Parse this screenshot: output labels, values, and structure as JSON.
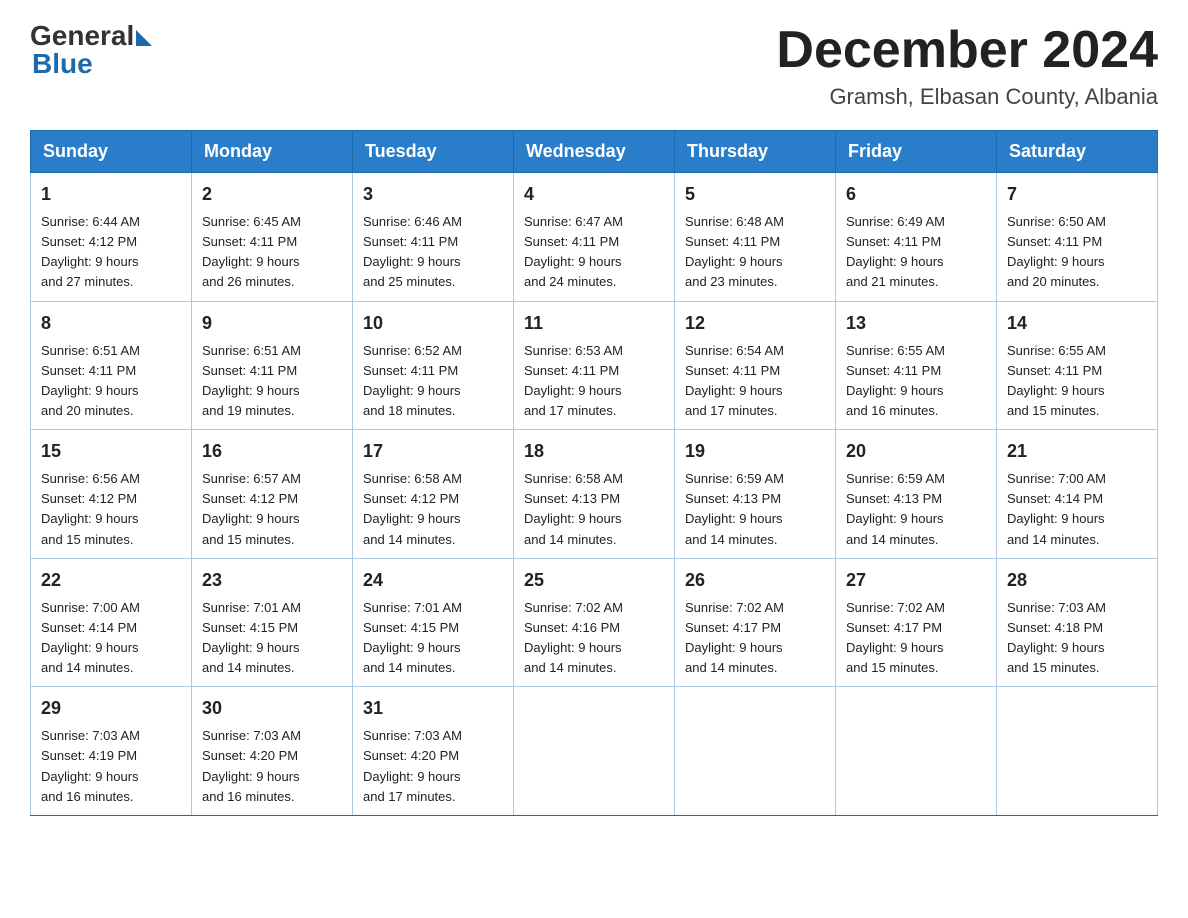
{
  "header": {
    "logo_general": "General",
    "logo_blue": "Blue",
    "title": "December 2024",
    "location": "Gramsh, Elbasan County, Albania"
  },
  "weekdays": [
    "Sunday",
    "Monday",
    "Tuesday",
    "Wednesday",
    "Thursday",
    "Friday",
    "Saturday"
  ],
  "weeks": [
    [
      {
        "day": "1",
        "sunrise": "6:44 AM",
        "sunset": "4:12 PM",
        "daylight": "9 hours and 27 minutes."
      },
      {
        "day": "2",
        "sunrise": "6:45 AM",
        "sunset": "4:11 PM",
        "daylight": "9 hours and 26 minutes."
      },
      {
        "day": "3",
        "sunrise": "6:46 AM",
        "sunset": "4:11 PM",
        "daylight": "9 hours and 25 minutes."
      },
      {
        "day": "4",
        "sunrise": "6:47 AM",
        "sunset": "4:11 PM",
        "daylight": "9 hours and 24 minutes."
      },
      {
        "day": "5",
        "sunrise": "6:48 AM",
        "sunset": "4:11 PM",
        "daylight": "9 hours and 23 minutes."
      },
      {
        "day": "6",
        "sunrise": "6:49 AM",
        "sunset": "4:11 PM",
        "daylight": "9 hours and 21 minutes."
      },
      {
        "day": "7",
        "sunrise": "6:50 AM",
        "sunset": "4:11 PM",
        "daylight": "9 hours and 20 minutes."
      }
    ],
    [
      {
        "day": "8",
        "sunrise": "6:51 AM",
        "sunset": "4:11 PM",
        "daylight": "9 hours and 20 minutes."
      },
      {
        "day": "9",
        "sunrise": "6:51 AM",
        "sunset": "4:11 PM",
        "daylight": "9 hours and 19 minutes."
      },
      {
        "day": "10",
        "sunrise": "6:52 AM",
        "sunset": "4:11 PM",
        "daylight": "9 hours and 18 minutes."
      },
      {
        "day": "11",
        "sunrise": "6:53 AM",
        "sunset": "4:11 PM",
        "daylight": "9 hours and 17 minutes."
      },
      {
        "day": "12",
        "sunrise": "6:54 AM",
        "sunset": "4:11 PM",
        "daylight": "9 hours and 17 minutes."
      },
      {
        "day": "13",
        "sunrise": "6:55 AM",
        "sunset": "4:11 PM",
        "daylight": "9 hours and 16 minutes."
      },
      {
        "day": "14",
        "sunrise": "6:55 AM",
        "sunset": "4:11 PM",
        "daylight": "9 hours and 15 minutes."
      }
    ],
    [
      {
        "day": "15",
        "sunrise": "6:56 AM",
        "sunset": "4:12 PM",
        "daylight": "9 hours and 15 minutes."
      },
      {
        "day": "16",
        "sunrise": "6:57 AM",
        "sunset": "4:12 PM",
        "daylight": "9 hours and 15 minutes."
      },
      {
        "day": "17",
        "sunrise": "6:58 AM",
        "sunset": "4:12 PM",
        "daylight": "9 hours and 14 minutes."
      },
      {
        "day": "18",
        "sunrise": "6:58 AM",
        "sunset": "4:13 PM",
        "daylight": "9 hours and 14 minutes."
      },
      {
        "day": "19",
        "sunrise": "6:59 AM",
        "sunset": "4:13 PM",
        "daylight": "9 hours and 14 minutes."
      },
      {
        "day": "20",
        "sunrise": "6:59 AM",
        "sunset": "4:13 PM",
        "daylight": "9 hours and 14 minutes."
      },
      {
        "day": "21",
        "sunrise": "7:00 AM",
        "sunset": "4:14 PM",
        "daylight": "9 hours and 14 minutes."
      }
    ],
    [
      {
        "day": "22",
        "sunrise": "7:00 AM",
        "sunset": "4:14 PM",
        "daylight": "9 hours and 14 minutes."
      },
      {
        "day": "23",
        "sunrise": "7:01 AM",
        "sunset": "4:15 PM",
        "daylight": "9 hours and 14 minutes."
      },
      {
        "day": "24",
        "sunrise": "7:01 AM",
        "sunset": "4:15 PM",
        "daylight": "9 hours and 14 minutes."
      },
      {
        "day": "25",
        "sunrise": "7:02 AM",
        "sunset": "4:16 PM",
        "daylight": "9 hours and 14 minutes."
      },
      {
        "day": "26",
        "sunrise": "7:02 AM",
        "sunset": "4:17 PM",
        "daylight": "9 hours and 14 minutes."
      },
      {
        "day": "27",
        "sunrise": "7:02 AM",
        "sunset": "4:17 PM",
        "daylight": "9 hours and 15 minutes."
      },
      {
        "day": "28",
        "sunrise": "7:03 AM",
        "sunset": "4:18 PM",
        "daylight": "9 hours and 15 minutes."
      }
    ],
    [
      {
        "day": "29",
        "sunrise": "7:03 AM",
        "sunset": "4:19 PM",
        "daylight": "9 hours and 16 minutes."
      },
      {
        "day": "30",
        "sunrise": "7:03 AM",
        "sunset": "4:20 PM",
        "daylight": "9 hours and 16 minutes."
      },
      {
        "day": "31",
        "sunrise": "7:03 AM",
        "sunset": "4:20 PM",
        "daylight": "9 hours and 17 minutes."
      },
      null,
      null,
      null,
      null
    ]
  ],
  "sunrise_label": "Sunrise:",
  "sunset_label": "Sunset:",
  "daylight_label": "Daylight:"
}
